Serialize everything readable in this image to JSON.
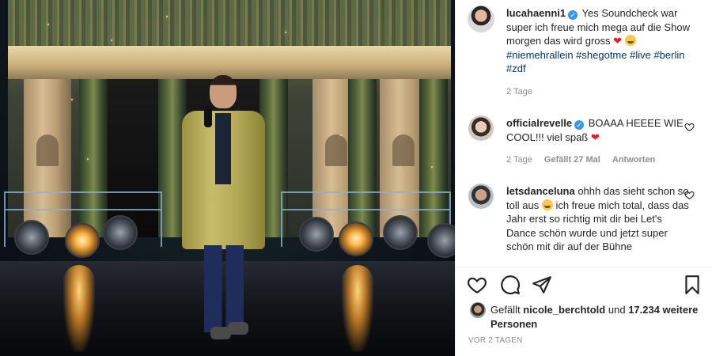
{
  "post": {
    "author": "lucahaenni1",
    "caption_text": "Yes Soundcheck war super ich freue mich mega auf die Show morgen das wird gross",
    "hashtags": "#niemehrallein #shegotme #live #berlin #zdf",
    "caption_time": "2 Tage"
  },
  "comments": [
    {
      "user": "officialrevelle",
      "text": "BOAAA HEEEE WIE COOL!!! viel spaß",
      "time": "2 Tage",
      "likes": "Gefällt 27 Mal",
      "reply": "Antworten"
    },
    {
      "user": "letsdanceluna",
      "text_before_emoji": "ohhh das sieht schon so toll aus",
      "text_after_emoji": "ich freue mich total, dass das Jahr erst so richtig mit dir bei Let's Dance schön wurde und jetzt super schön mit dir auf der Bühne"
    }
  ],
  "likes": {
    "prefix": "Gefällt",
    "liker": "nicole_berchtold",
    "connector": "und",
    "others": "17.234 weitere Personen"
  },
  "timestamp": "VOR 2 TAGEN",
  "icons": {
    "like": "heart-icon",
    "comment": "comment-bubble-icon",
    "share": "paper-plane-icon",
    "save": "bookmark-icon",
    "verified": "verified-badge-icon"
  },
  "colors": {
    "verified": "#3897f0",
    "hashtag": "#00376b",
    "secondary_text": "#8e8e8e",
    "heart_emoji": "#ed1c24"
  }
}
